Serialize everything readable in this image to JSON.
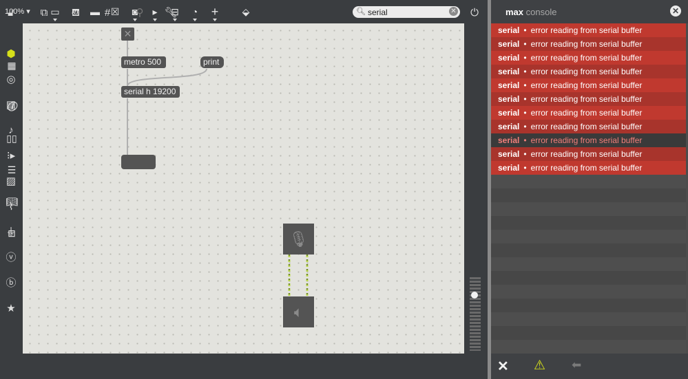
{
  "toolbar": {
    "zoom": "100%",
    "search_value": "serial"
  },
  "patch": {
    "metro_label": "metro 500",
    "print_label": "print",
    "serial_label": "serial h 19200"
  },
  "console": {
    "title_bold": "max",
    "title_rest": " console",
    "rows": [
      {
        "source": "serial",
        "message": "error reading from serial buffer",
        "state": "error"
      },
      {
        "source": "serial",
        "message": "error reading from serial buffer",
        "state": "error"
      },
      {
        "source": "serial",
        "message": "error reading from serial buffer",
        "state": "error"
      },
      {
        "source": "serial",
        "message": "error reading from serial buffer",
        "state": "error"
      },
      {
        "source": "serial",
        "message": "error reading from serial buffer",
        "state": "error"
      },
      {
        "source": "serial",
        "message": "error reading from serial buffer",
        "state": "error"
      },
      {
        "source": "serial",
        "message": "error reading from serial buffer",
        "state": "error"
      },
      {
        "source": "serial",
        "message": "error reading from serial buffer",
        "state": "error"
      },
      {
        "source": "serial",
        "message": "error reading from serial buffer",
        "state": "selected"
      },
      {
        "source": "serial",
        "message": "error reading from serial buffer",
        "state": "error"
      },
      {
        "source": "serial",
        "message": "error reading from serial buffer",
        "state": "error"
      }
    ]
  },
  "colors": {
    "error_row_a": "#c0392f",
    "error_row_b": "#a8342c",
    "selected_row": "#3a3a3a",
    "selected_text": "#f07f7a",
    "warning": "#d6e01a"
  },
  "icons": {
    "left_sidebar": [
      "cube-icon",
      "circle-icon",
      "bus-icon",
      "music-note-icon",
      "play-grid-icon",
      "image-icon",
      "paperclip-icon",
      "plug-icon",
      "v-icon",
      "b-icon",
      "star-icon"
    ],
    "right_sidebar": [
      "grid-icon",
      "info-icon",
      "book-open-icon",
      "list-icon",
      "book-icon",
      "camera-icon",
      "volume-slider"
    ],
    "bottom_bar": [
      "lock-icon",
      "windows-icon",
      "presentation-icon",
      "grid-hash-icon",
      "pin-icon",
      "wrench-icon",
      "power-icon"
    ],
    "console_foot": [
      "clear-x-icon",
      "warning-icon",
      "back-arrow-icon"
    ]
  }
}
